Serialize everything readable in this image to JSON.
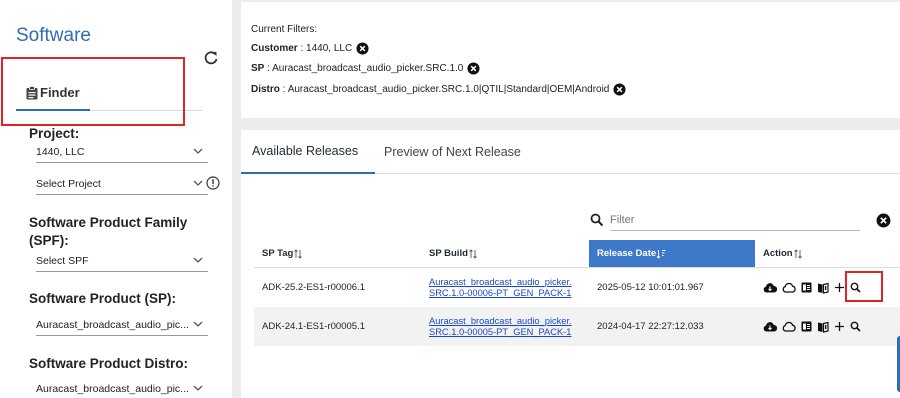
{
  "sidebar": {
    "title": "Software",
    "finder_tab": "Finder",
    "fields": [
      {
        "label": "Project:",
        "value": "1440, LLC"
      },
      {
        "label": "",
        "value": "Select Project"
      },
      {
        "label": "Software Product Family (SPF):",
        "value": "Select SPF"
      },
      {
        "label": "Software Product (SP):",
        "value": "Auracast_broadcast_audio_pic..."
      },
      {
        "label": "Software Product Distro:",
        "value": "Auracast_broadcast_audio_pic..."
      }
    ]
  },
  "filters": {
    "heading": "Current Filters:",
    "items": [
      {
        "key": "Customer",
        "value": " : 1440, LLC"
      },
      {
        "key": "SP",
        "value": " : Auracast_broadcast_audio_picker.SRC.1.0"
      },
      {
        "key": "Distro",
        "value": " : Auracast_broadcast_audio_picker.SRC.1.0|QTIL|Standard|OEM|Android"
      }
    ]
  },
  "releases": {
    "tabs": [
      "Available Releases",
      "Preview of Next Release"
    ],
    "filter_placeholder": "Filter",
    "columns": [
      "SP Tag",
      "SP Build",
      "Release Date",
      "Action"
    ],
    "rows": [
      {
        "tag": "ADK-25.2-ES1-r00006.1",
        "build_l1": "Auracast_broadcast_audio_picker.",
        "build_l2": "SRC.1.0-00006-PT_GEN_PACK-1",
        "date": "2025-05-12 10:01:01.967"
      },
      {
        "tag": "ADK-24.1-ES1-r00005.1",
        "build_l1": "Auracast_broadcast_audio_picker.",
        "build_l2": "SRC.1.0-00005-PT_GEN_PACK-1",
        "date": "2024-04-17 22:27:12.033"
      }
    ]
  },
  "colors": {
    "accent": "#2e6db4",
    "sorted_header": "#3e78c8",
    "highlight": "#e02424",
    "link": "#1a47c8"
  }
}
